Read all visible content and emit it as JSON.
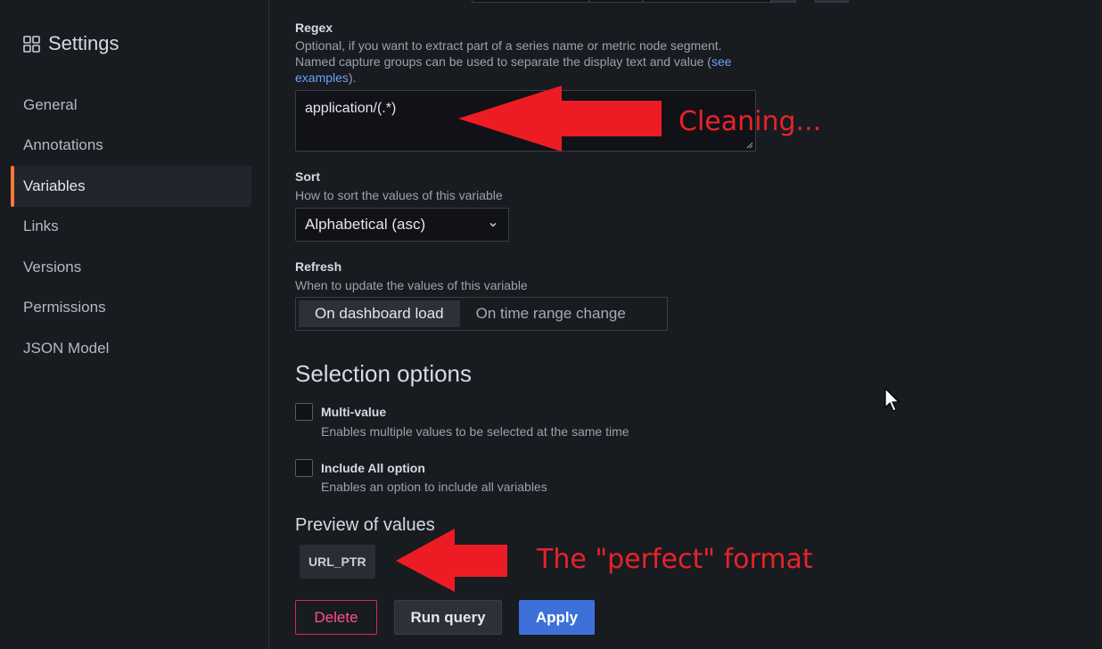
{
  "sidebar": {
    "title": "Settings",
    "title_icon": "grid-icon",
    "items": [
      {
        "label": "General",
        "active": false
      },
      {
        "label": "Annotations",
        "active": false
      },
      {
        "label": "Variables",
        "active": true
      },
      {
        "label": "Links",
        "active": false
      },
      {
        "label": "Versions",
        "active": false
      },
      {
        "label": "Permissions",
        "active": false
      },
      {
        "label": "JSON Model",
        "active": false
      }
    ],
    "accent_color": "#ff7a38"
  },
  "regex": {
    "label": "Regex",
    "description_line1": "Optional, if you want to extract part of a series name or metric node segment.",
    "description_line2_prefix": "Named capture groups can be used to separate the display text and value (",
    "description_link_1": "see",
    "description_link_2": "examples",
    "description_suffix": ").",
    "value": "application/(.*)"
  },
  "sort": {
    "label": "Sort",
    "description": "How to sort the values of this variable",
    "selected": "Alphabetical (asc)"
  },
  "refresh": {
    "label": "Refresh",
    "description": "When to update the values of this variable",
    "options": [
      "On dashboard load",
      "On time range change"
    ],
    "selected": "On dashboard load"
  },
  "selection_options": {
    "heading": "Selection options",
    "multi_value": {
      "label": "Multi-value",
      "description": "Enables multiple values to be selected at the same time",
      "checked": false
    },
    "include_all": {
      "label": "Include All option",
      "description": "Enables an option to include all variables",
      "checked": false
    }
  },
  "preview": {
    "heading": "Preview of values",
    "values": [
      "URL_PTR"
    ]
  },
  "buttons": {
    "delete": "Delete",
    "run_query": "Run query",
    "apply": "Apply"
  },
  "annotations": {
    "regex_note": "Cleaning...",
    "preview_note": "The \"perfect\" format",
    "color": "#e8232a"
  }
}
